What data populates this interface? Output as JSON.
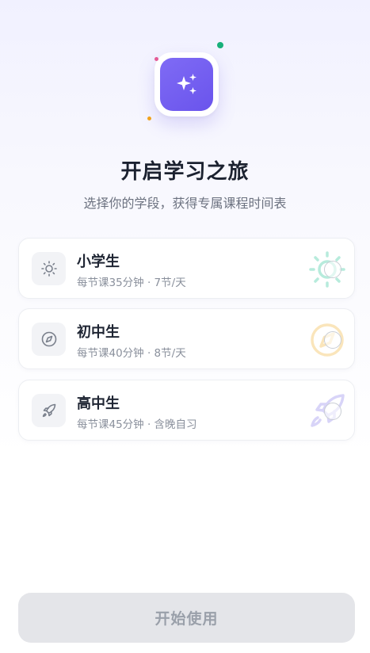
{
  "header": {
    "title": "开启学习之旅",
    "subtitle": "选择你的学段，获得专属课程时间表"
  },
  "options": [
    {
      "title": "小学生",
      "description": "每节课35分钟 · 7节/天",
      "icon": "sun-icon",
      "selected": false
    },
    {
      "title": "初中生",
      "description": "每节课40分钟 · 8节/天",
      "icon": "compass-icon",
      "selected": false
    },
    {
      "title": "高中生",
      "description": "每节课45分钟 · 含晚自习",
      "icon": "rocket-icon",
      "selected": false
    }
  ],
  "footer": {
    "start_label": "开始使用",
    "enabled": false
  },
  "colors": {
    "accent": "#6c56ee",
    "green": "#18b07a",
    "pink": "#e45a96",
    "orange": "#f1a21c",
    "button_disabled": "#e4e5e9"
  }
}
